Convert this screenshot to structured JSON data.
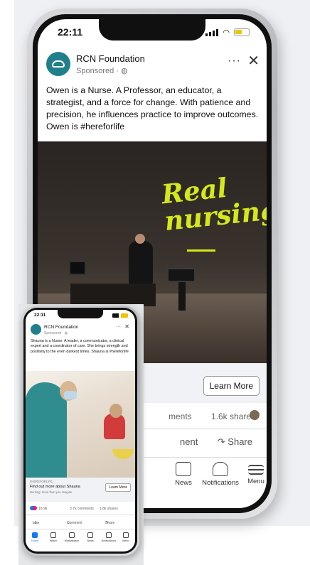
{
  "large_phone": {
    "status_time": "22:11",
    "page_name": "RCN Foundation",
    "sponsored": "Sponsored · ",
    "more": "···",
    "close": "✕",
    "post_text": "Owen is a Nurse. A Professor, an educator, a strategist, and a force for change. With patience and precision, he influences practice to improve outcomes. Owen is #hereforlife",
    "hero_title": "Real nursing",
    "cta_label": "Learn More",
    "stats_comments": "ments",
    "stats_shares": "1.6k shares",
    "action_comment": "nent",
    "action_share": "Share",
    "tabs": {
      "news": "News",
      "notifications": "Notifications",
      "menu": "Menu"
    }
  },
  "small_phone": {
    "status_time": "22:11",
    "page_name": "RCN Foundation",
    "sponsored": "Sponsored · ",
    "more": "···",
    "close": "✕",
    "post_text": "Shauna is a Nurse. A leader, a communicator, a clinical expert and a coordinator of care. She brings strength and positivity to the even darkest times. Shauna is #hereforlife",
    "cta_tag": "#HEREFORLIFE",
    "cta_title": "Find out more about Shauna",
    "cta_sub": "Nursing: more than you imagine",
    "cta_label": "Learn More",
    "likes": "16.9k",
    "comments": "3.7k comments",
    "shares": "1.8k shares",
    "action_like": "Like",
    "action_comment": "Comment",
    "action_share": "Share",
    "tabs": [
      "Home",
      "Watch",
      "Marketplace",
      "News",
      "Notifications",
      "Menu"
    ]
  },
  "colors": {
    "brand_teal": "#1f7f8a",
    "hero_accent": "#d4e81c",
    "facebook_blue": "#1877f2"
  }
}
